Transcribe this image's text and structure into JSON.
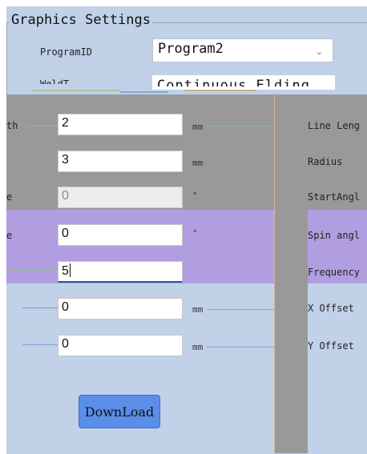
{
  "group": {
    "title": "Graphics Settings"
  },
  "program": {
    "label": "ProgramID",
    "value": "Program2"
  },
  "weld": {
    "label": "WeldT",
    "value": "Continuous Elding"
  },
  "rows": [
    {
      "left_label": "th",
      "value": "2",
      "unit": "mm",
      "right_label": "Line Leng"
    },
    {
      "left_label": "",
      "value": "3",
      "unit": "mm",
      "right_label": "Radius"
    },
    {
      "left_label": "e",
      "value": "0",
      "unit": "°",
      "right_label": "StartAngl"
    },
    {
      "left_label": "e",
      "value": "0",
      "unit": "°",
      "right_label": "Spin angl"
    },
    {
      "left_label": "",
      "value": "5",
      "unit": "",
      "right_label": "Frequency"
    },
    {
      "left_label": "",
      "value": "0",
      "unit": "mm",
      "right_label": "X Offset"
    },
    {
      "left_label": "",
      "value": "0",
      "unit": "mm",
      "right_label": "Y Offset"
    }
  ],
  "download_label": "DownLoad",
  "icons": {
    "dropdown": "chevron-down-icon"
  },
  "colors": {
    "panel": "#c0d1e8",
    "gray": "#999999",
    "purple": "#b19ee0",
    "button": "#5a8ee8"
  }
}
